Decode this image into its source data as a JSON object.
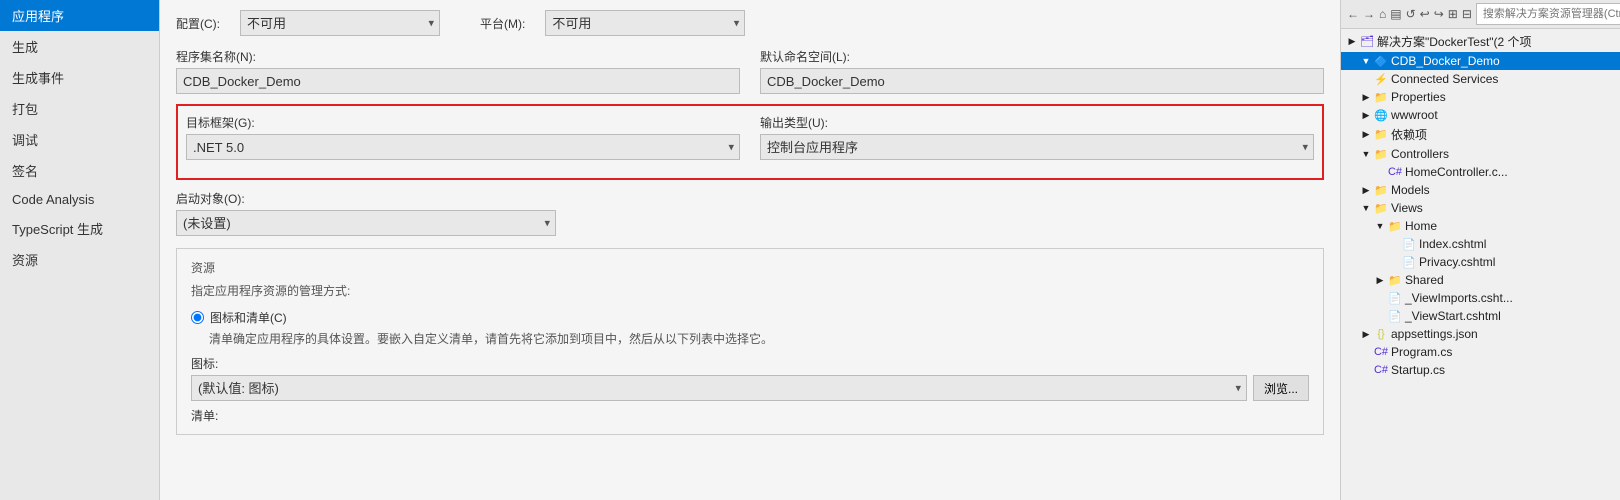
{
  "sidebar": {
    "items": [
      {
        "id": "app",
        "label": "应用程序",
        "active": true
      },
      {
        "id": "build",
        "label": "生成",
        "active": false
      },
      {
        "id": "build-events",
        "label": "生成事件",
        "active": false
      },
      {
        "id": "package",
        "label": "打包",
        "active": false
      },
      {
        "id": "debug",
        "label": "调试",
        "active": false
      },
      {
        "id": "sign",
        "label": "签名",
        "active": false
      },
      {
        "id": "code-analysis",
        "label": "Code Analysis",
        "active": false
      },
      {
        "id": "typescript",
        "label": "TypeScript 生成",
        "active": false
      },
      {
        "id": "resources",
        "label": "资源",
        "active": false
      }
    ]
  },
  "config_row": {
    "config_label": "配置(C):",
    "config_value": "不可用",
    "platform_label": "平台(M):",
    "platform_value": "不可用"
  },
  "assembly_row": {
    "assembly_label": "程序集名称(N):",
    "assembly_value": "CDB_Docker_Demo",
    "namespace_label": "默认命名空间(L):",
    "namespace_value": "CDB_Docker_Demo"
  },
  "target_row": {
    "target_label": "目标框架(G):",
    "target_value": ".NET 5.0",
    "output_label": "输出类型(U):",
    "output_value": "控制台应用程序"
  },
  "startup_row": {
    "startup_label": "启动对象(O):",
    "startup_value": "(未设置)"
  },
  "resources_section": {
    "title": "资源",
    "description": "指定应用程序资源的管理方式:",
    "radio_label": "图标和清单(C)",
    "radio_desc": "清单确定应用程序的具体设置。要嵌入自定义清单，请首先将它添加到项目中，然后从以下列表中选择它。",
    "icon_label": "图标:",
    "icon_placeholder": "(默认值: 图标)",
    "browse_btn": "浏览...",
    "list_label": "清单:"
  },
  "right_panel": {
    "search_placeholder": "搜索解决方案资源管理器(Ctrl+;)",
    "solution_label": "解决方案\"DockerTest\"(2 个项",
    "project_label": "CDB_Docker_Demo",
    "tree_items": [
      {
        "id": "connected-services",
        "label": "Connected Services",
        "indent": 2,
        "expand": "",
        "icon": "⚡",
        "icon_class": "icon-wrench"
      },
      {
        "id": "properties",
        "label": "Properties",
        "indent": 2,
        "expand": "▶",
        "icon": "📁",
        "icon_class": "icon-folder"
      },
      {
        "id": "wwwroot",
        "label": "wwwroot",
        "indent": 2,
        "expand": "▶",
        "icon": "🌐",
        "icon_class": "icon-globe"
      },
      {
        "id": "dependencies",
        "label": "依赖项",
        "indent": 2,
        "expand": "▶",
        "icon": "📁",
        "icon_class": "icon-folder"
      },
      {
        "id": "controllers",
        "label": "Controllers",
        "indent": 2,
        "expand": "▼",
        "icon": "📁",
        "icon_class": "icon-folder"
      },
      {
        "id": "homecontroller",
        "label": "HomeController.c...",
        "indent": 4,
        "expand": "",
        "icon": "C#",
        "icon_class": "icon-cs"
      },
      {
        "id": "models",
        "label": "Models",
        "indent": 2,
        "expand": "▶",
        "icon": "📁",
        "icon_class": "icon-folder"
      },
      {
        "id": "views",
        "label": "Views",
        "indent": 2,
        "expand": "▼",
        "icon": "📁",
        "icon_class": "icon-folder"
      },
      {
        "id": "home",
        "label": "Home",
        "indent": 4,
        "expand": "▼",
        "icon": "📁",
        "icon_class": "icon-folder"
      },
      {
        "id": "index-cshtml",
        "label": "Index.cshtml",
        "indent": 6,
        "expand": "",
        "icon": "📄",
        "icon_class": "icon-cshtml"
      },
      {
        "id": "privacy-cshtml",
        "label": "Privacy.cshtml",
        "indent": 6,
        "expand": "",
        "icon": "📄",
        "icon_class": "icon-cshtml"
      },
      {
        "id": "shared",
        "label": "Shared",
        "indent": 4,
        "expand": "▶",
        "icon": "📁",
        "icon_class": "icon-folder"
      },
      {
        "id": "viewimports",
        "label": "_ViewImports.csht...",
        "indent": 4,
        "expand": "",
        "icon": "📄",
        "icon_class": "icon-cshtml"
      },
      {
        "id": "viewstart",
        "label": "_ViewStart.cshtml",
        "indent": 4,
        "expand": "",
        "icon": "📄",
        "icon_class": "icon-cshtml"
      },
      {
        "id": "appsettings",
        "label": "appsettings.json",
        "indent": 2,
        "expand": "▶",
        "icon": "{ }",
        "icon_class": "icon-json"
      },
      {
        "id": "program",
        "label": "Program.cs",
        "indent": 2,
        "expand": "",
        "icon": "C#",
        "icon_class": "icon-cs"
      },
      {
        "id": "startup",
        "label": "Startup.cs",
        "indent": 2,
        "expand": "",
        "icon": "C#",
        "icon_class": "icon-cs"
      }
    ]
  },
  "icons": {
    "back": "←",
    "forward": "→",
    "home": "⌂",
    "sync": "↺",
    "undo": "↩",
    "redo": "↪",
    "expand_all": "⊞",
    "collapse_all": "⊟"
  }
}
